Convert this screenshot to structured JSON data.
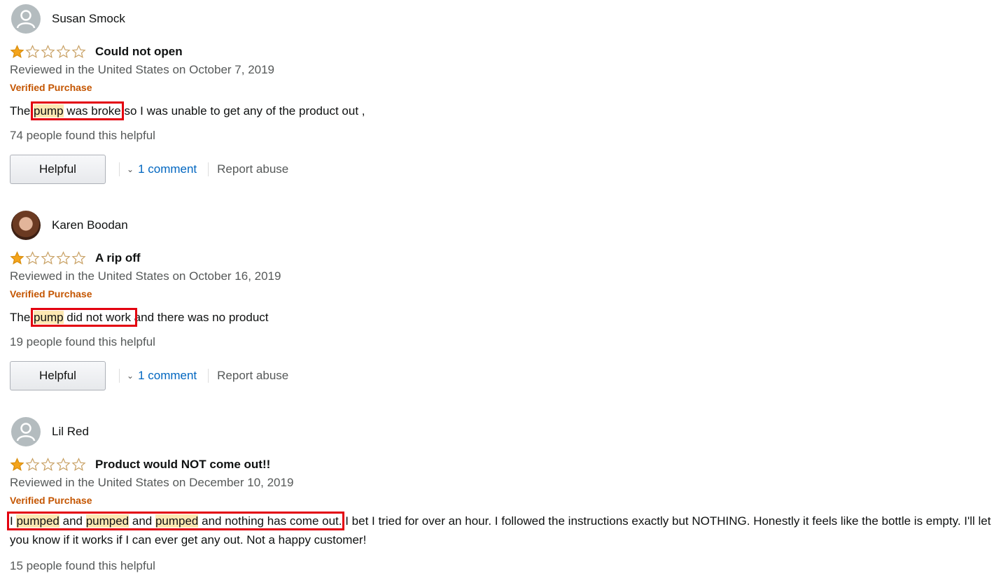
{
  "colors": {
    "star": "#f4a41b",
    "verified": "#c45500",
    "link": "#0066c0",
    "highlight_box": "#e3000f",
    "highlight_fill": "#fde8b2"
  },
  "reviews": [
    {
      "name": "Susan Smock",
      "avatar": "default-avatar",
      "rating": 1,
      "max_rating": 5,
      "title": "Could not open",
      "date": "Reviewed in the United States on October 7, 2019",
      "verified": "Verified Purchase",
      "body": {
        "pre": "The ",
        "hl1": "pump",
        "box_rest": " was broke",
        "post": " so I was unable to get any of the product out ,"
      },
      "helpful_count": "74 people found this helpful",
      "helpful_label": "Helpful",
      "comments": "1 comment",
      "report": "Report abuse"
    },
    {
      "name": "Karen Boodan",
      "avatar": "photo-avatar",
      "rating": 1,
      "max_rating": 5,
      "title": "A rip off",
      "date": "Reviewed in the United States on October 16, 2019",
      "verified": "Verified Purchase",
      "body": {
        "pre": "The ",
        "hl1": "pump",
        "box_rest": " did not work ",
        "post": "and there was no product"
      },
      "helpful_count": "19 people found this helpful",
      "helpful_label": "Helpful",
      "comments": "1 comment",
      "report": "Report abuse"
    },
    {
      "name": "Lil Red",
      "avatar": "default-avatar",
      "rating": 1,
      "max_rating": 5,
      "title": "Product would NOT come out!!",
      "date": "Reviewed in the United States on December 10, 2019",
      "verified": "Verified Purchase",
      "body": {
        "box_pre": "I ",
        "hl1": "pumped",
        "mid1": " and ",
        "hl2": "pumped",
        "mid2": " and ",
        "hl3": "pumped",
        "box_rest": " and nothing has come out.",
        "post": " I bet I tried for over an hour. I followed the instructions exactly but NOTHING. Honestly it feels like the bottle is empty. I'll let you know if it works if I can ever get any out. Not a happy customer!"
      },
      "helpful_count": "15 people found this helpful"
    }
  ]
}
